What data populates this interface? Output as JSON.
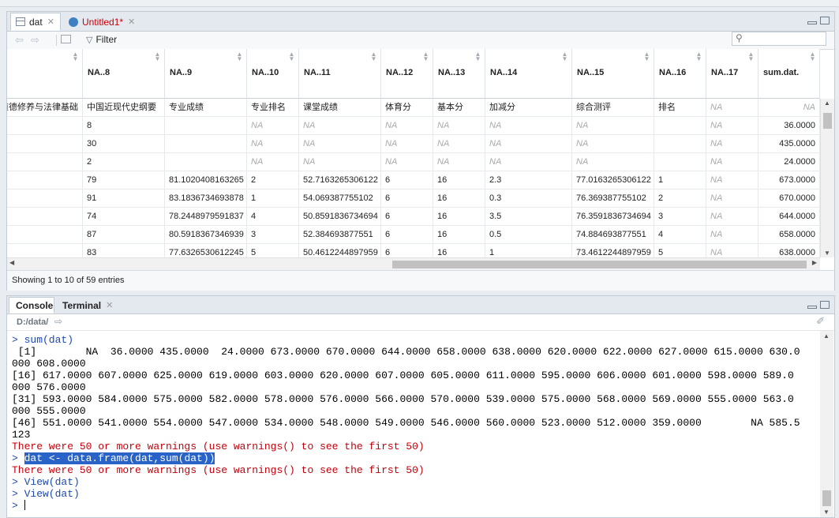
{
  "viewer": {
    "tabs": [
      {
        "label": "dat",
        "active": true
      },
      {
        "label": "Untitled1*",
        "active": false
      }
    ],
    "filter_label": "Filter",
    "search_placeholder": "",
    "status": "Showing 1 to 10 of 59 entries"
  },
  "table": {
    "columns": [
      "",
      "NA..8",
      "NA..9",
      "NA..10",
      "NA..11",
      "NA..12",
      "NA..13",
      "NA..14",
      "NA..15",
      "NA..16",
      "NA..17",
      "sum.dat."
    ],
    "rows": [
      [
        "道德修养与法律基础",
        "中国近现代史纲要",
        "专业成绩",
        "专业排名",
        "课堂成绩",
        "体育分",
        "基本分",
        "加减分",
        "综合测评",
        "排名",
        "NA",
        "NA"
      ],
      [
        "",
        "8",
        "",
        "NA",
        "NA",
        "NA",
        "NA",
        "NA",
        "NA",
        "",
        "NA",
        "36.0000"
      ],
      [
        "",
        "30",
        "",
        "NA",
        "NA",
        "NA",
        "NA",
        "NA",
        "NA",
        "",
        "NA",
        "435.0000"
      ],
      [
        "",
        "2",
        "",
        "NA",
        "NA",
        "NA",
        "NA",
        "NA",
        "NA",
        "",
        "NA",
        "24.0000"
      ],
      [
        "",
        "79",
        "81.1020408163265",
        "2",
        "52.7163265306122",
        "6",
        "16",
        "2.3",
        "77.0163265306122",
        "1",
        "NA",
        "673.0000"
      ],
      [
        "",
        "91",
        "83.1836734693878",
        "1",
        "54.069387755102",
        "6",
        "16",
        "0.3",
        "76.369387755102",
        "2",
        "NA",
        "670.0000"
      ],
      [
        "",
        "74",
        "78.2448979591837",
        "4",
        "50.8591836734694",
        "6",
        "16",
        "3.5",
        "76.3591836734694",
        "3",
        "NA",
        "644.0000"
      ],
      [
        "",
        "87",
        "80.5918367346939",
        "3",
        "52.384693877551",
        "6",
        "16",
        "0.5",
        "74.884693877551",
        "4",
        "NA",
        "658.0000"
      ],
      [
        "",
        "83",
        "77.6326530612245",
        "5",
        "50.4612244897959",
        "6",
        "16",
        "1",
        "73.4612244897959",
        "5",
        "NA",
        "638.0000"
      ]
    ]
  },
  "console": {
    "tabs": [
      {
        "label": "Console",
        "active": true
      },
      {
        "label": "Terminal",
        "active": false
      }
    ],
    "path": "D:/data/",
    "lines": [
      {
        "type": "cmd",
        "text": "> sum(dat)"
      },
      {
        "type": "out",
        "text": " [1]        NA  36.0000 435.0000  24.0000 673.0000 670.0000 644.0000 658.0000 638.0000 620.0000 622.0000 627.0000 615.0000 630.0"
      },
      {
        "type": "out",
        "text": "000 608.0000"
      },
      {
        "type": "out",
        "text": "[16] 617.0000 607.0000 625.0000 619.0000 603.0000 620.0000 607.0000 605.0000 611.0000 595.0000 606.0000 601.0000 598.0000 589.0"
      },
      {
        "type": "out",
        "text": "000 576.0000"
      },
      {
        "type": "out",
        "text": "[31] 593.0000 584.0000 575.0000 582.0000 578.0000 576.0000 566.0000 570.0000 539.0000 575.0000 568.0000 569.0000 555.0000 563.0"
      },
      {
        "type": "out",
        "text": "000 555.0000"
      },
      {
        "type": "out",
        "text": "[46] 551.0000 541.0000 554.0000 547.0000 534.0000 548.0000 549.0000 546.0000 560.0000 523.0000 512.0000 359.0000        NA 585.5"
      },
      {
        "type": "out",
        "text": "123"
      },
      {
        "type": "warn",
        "text": "There were 50 or more warnings (use warnings() to see the first 50)"
      },
      {
        "type": "cmdsel",
        "prompt": "> ",
        "text": "dat <- data.frame(dat,sum(dat))"
      },
      {
        "type": "warn",
        "text": "There were 50 or more warnings (use warnings() to see the first 50)"
      },
      {
        "type": "cmd",
        "text": "> View(dat)"
      },
      {
        "type": "cmd",
        "text": "> View(dat)"
      },
      {
        "type": "prompt",
        "text": "> "
      }
    ]
  },
  "colors": {
    "command": "#1c49b4",
    "warning": "#c5000b",
    "selection": "#2a63c7",
    "na_text": "#a8a8a8"
  }
}
